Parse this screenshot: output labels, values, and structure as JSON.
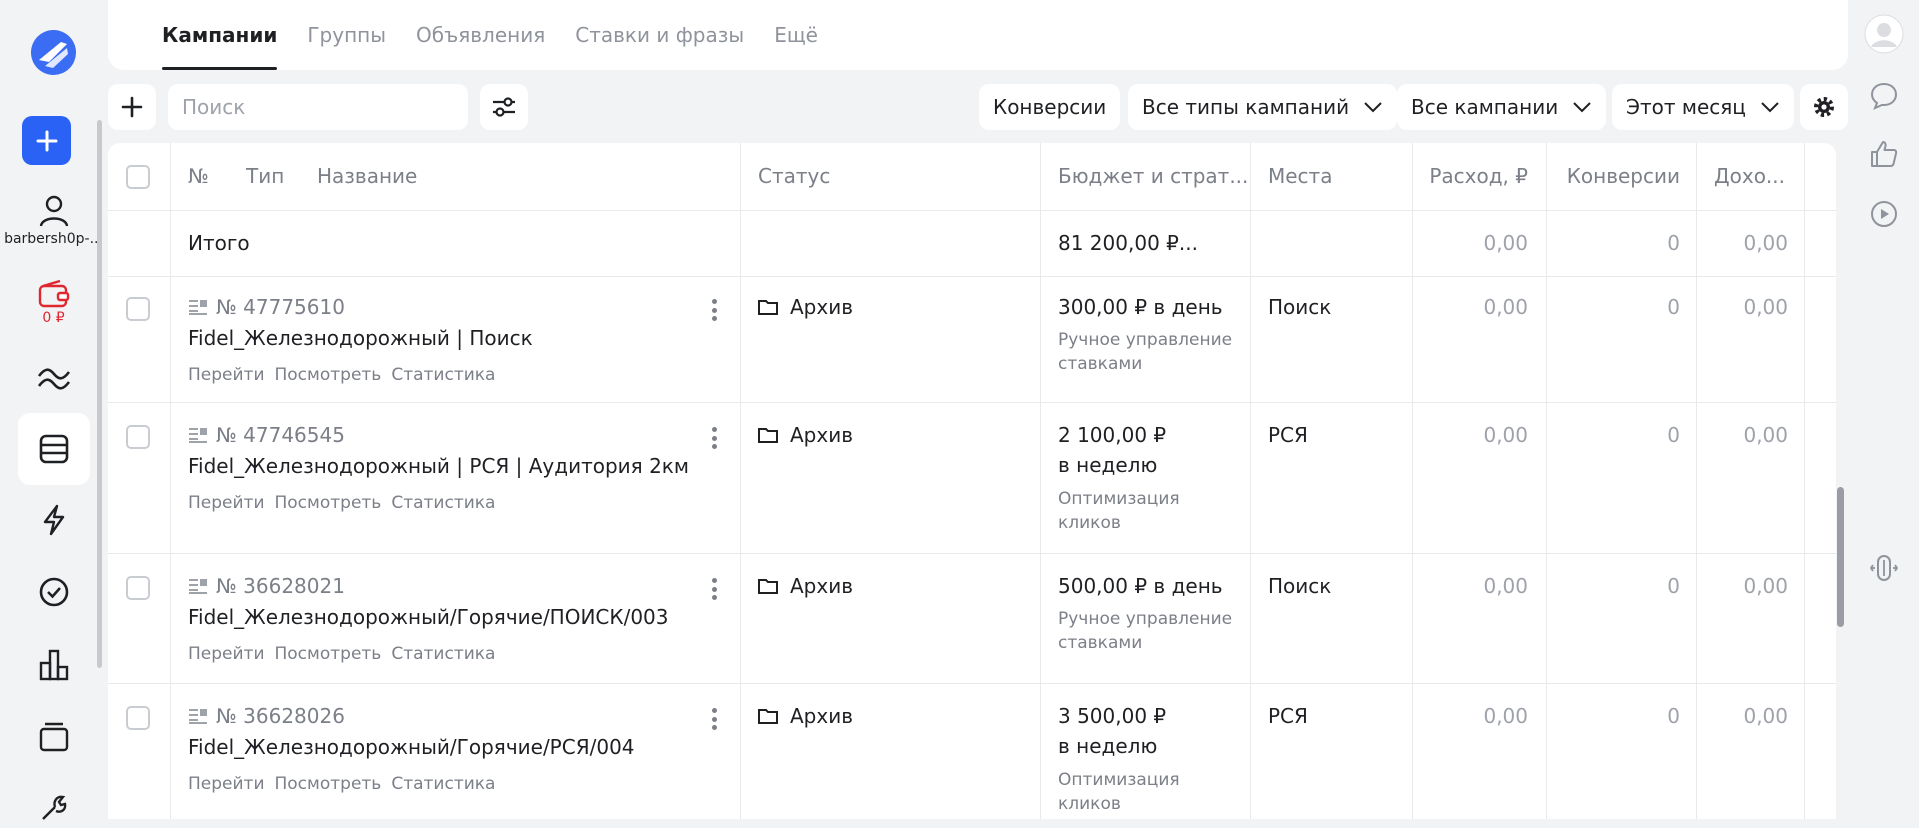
{
  "sidebar": {
    "user_label": "barbersh0p-...",
    "balance": "0 ₽",
    "icons": [
      "logo-icon",
      "plus-icon",
      "user-icon",
      "wallet-icon",
      "waves-icon",
      "campaigns-icon",
      "lightning-icon",
      "check-circle-icon",
      "bar-chart-icon",
      "layers-icon",
      "wrench-icon"
    ]
  },
  "tabs": [
    {
      "label": "Кампании",
      "active": true
    },
    {
      "label": "Группы"
    },
    {
      "label": "Объявления"
    },
    {
      "label": "Ставки и фразы"
    },
    {
      "label": "Ещё"
    }
  ],
  "toolbar": {
    "search_placeholder": "Поиск",
    "conversions": "Конверсии",
    "types": "Все типы кампаний",
    "campaigns": "Все кампании",
    "period": "Этот месяц"
  },
  "table": {
    "headers": {
      "num": "№",
      "type": "Тип",
      "name": "Название",
      "status": "Статус",
      "budget": "Бюджет и страт...",
      "places": "Места",
      "spend": "Расход, ₽",
      "conversions": "Конверсии",
      "income": "Дохо..."
    },
    "total": {
      "label": "Итого",
      "budget": "81 200,00 ₽...",
      "spend": "0,00",
      "conversions": "0",
      "income": "0,00"
    },
    "link_labels": {
      "go": "Перейти",
      "view": "Посмотреть",
      "stats": "Статистика"
    },
    "rows": [
      {
        "id": "№ 47775610",
        "name": "Fidel_Железнодорожный | Поиск",
        "status": "Архив",
        "budget_line1": "300,00 ₽ в день",
        "budget_line2": "",
        "strategy_line1": "Ручное управление",
        "strategy_line2": "ставками",
        "places": "Поиск",
        "spend": "0,00",
        "conversions": "0",
        "income": "0,00"
      },
      {
        "id": "№ 47746545",
        "name": "Fidel_Железнодорожный | РСЯ | Аудитория 2км",
        "status": "Архив",
        "budget_line1": "2 100,00 ₽",
        "budget_line2": "в неделю",
        "strategy_line1": "Оптимизация",
        "strategy_line2": "кликов",
        "places": "РСЯ",
        "spend": "0,00",
        "conversions": "0",
        "income": "0,00"
      },
      {
        "id": "№ 36628021",
        "name": "Fidel_Железнодорожный/Горячие/ПОИСК/003",
        "status": "Архив",
        "budget_line1": "500,00 ₽ в день",
        "budget_line2": "",
        "strategy_line1": "Ручное управление",
        "strategy_line2": "ставками",
        "places": "Поиск",
        "spend": "0,00",
        "conversions": "0",
        "income": "0,00"
      },
      {
        "id": "№ 36628026",
        "name": "Fidel_Железнодорожный/Горячие/РСЯ/004",
        "status": "Архив",
        "budget_line1": "3 500,00 ₽",
        "budget_line2": "в неделю",
        "strategy_line1": "Оптимизация",
        "strategy_line2": "кликов",
        "places": "РСЯ",
        "spend": "0,00",
        "conversions": "0",
        "income": "0,00"
      }
    ]
  },
  "colors": {
    "accent": "#2a62f5",
    "balance": "#e0262f",
    "background": "#f2f3f5"
  }
}
